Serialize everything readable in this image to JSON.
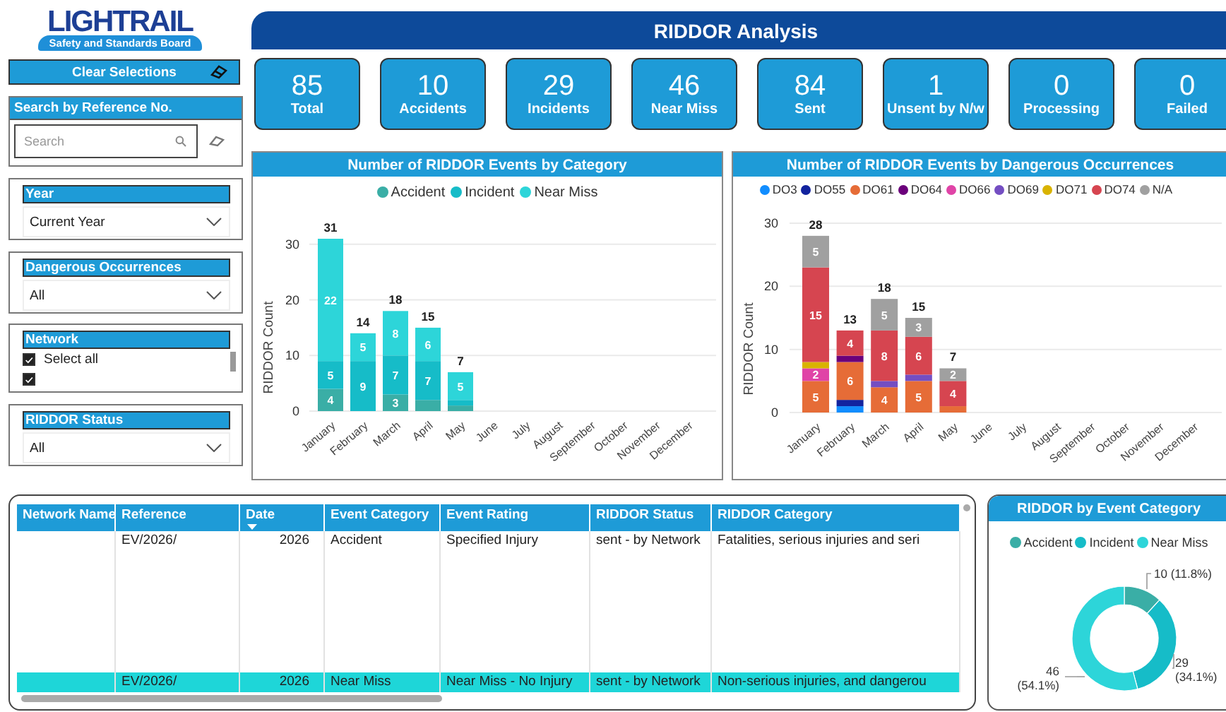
{
  "logo": {
    "name": "LIGHTRAIL",
    "tagline": "Safety and Standards Board"
  },
  "sidebar": {
    "clear_button": "Clear Selections",
    "search": {
      "title": "Search by Reference No.",
      "placeholder": "Search"
    },
    "filters": [
      {
        "kind": "dropdown",
        "title": "Year",
        "value": "Current Year"
      },
      {
        "kind": "dropdown",
        "title": "Dangerous Occurrences",
        "value": "All"
      },
      {
        "kind": "checklist",
        "title": "Network",
        "items": [
          {
            "label": "Select all",
            "checked": true
          },
          {
            "checked": true
          }
        ]
      },
      {
        "kind": "dropdown",
        "title": "RIDDOR Status",
        "value": "All"
      }
    ]
  },
  "header": {
    "title": "RIDDOR Analysis"
  },
  "kpis": [
    {
      "value": "85",
      "label": "Total"
    },
    {
      "value": "10",
      "label": "Accidents"
    },
    {
      "value": "29",
      "label": "Incidents"
    },
    {
      "value": "46",
      "label": "Near Miss"
    },
    {
      "value": "84",
      "label": "Sent"
    },
    {
      "value": "1",
      "label": "Unsent by N/w"
    },
    {
      "value": "0",
      "label": "Processing"
    },
    {
      "value": "0",
      "label": "Failed"
    }
  ],
  "category_chart": {
    "chart_data": {
      "type": "bar",
      "title": "Number of RIDDOR Events by Category",
      "ylabel": "RIDDOR Count",
      "stacked": true,
      "grid": true,
      "ylim": [
        0,
        31
      ],
      "yticks": [
        0,
        10,
        20,
        30
      ],
      "categories": [
        "January",
        "February",
        "March",
        "April",
        "May",
        "June",
        "July",
        "August",
        "September",
        "October",
        "November",
        "December"
      ],
      "series": [
        {
          "name": "Accident",
          "color": "#3aaea6",
          "values": [
            4,
            null,
            3,
            2,
            1,
            null,
            null,
            null,
            null,
            null,
            null,
            null
          ],
          "value_labels": [
            "4",
            null,
            "3",
            null,
            null,
            null,
            null,
            null,
            null,
            null,
            null,
            null
          ]
        },
        {
          "name": "Incident",
          "color": "#16bcc8",
          "values": [
            5,
            9,
            7,
            7,
            1,
            null,
            null,
            null,
            null,
            null,
            null,
            null
          ],
          "value_labels": [
            "5",
            "9",
            "7",
            "7",
            null,
            null,
            null,
            null,
            null,
            null,
            null,
            null
          ]
        },
        {
          "name": "Near Miss",
          "color": "#2dd5d9",
          "values": [
            22,
            5,
            8,
            6,
            5,
            null,
            null,
            null,
            null,
            null,
            null,
            null
          ],
          "value_labels": [
            "22",
            "5",
            "8",
            "6",
            "5",
            null,
            null,
            null,
            null,
            null,
            null,
            null
          ]
        }
      ],
      "annotations": [
        {
          "text": "31"
        },
        {
          "text": "14"
        },
        {
          "text": "18"
        },
        {
          "text": "15"
        },
        {
          "text": "7"
        }
      ]
    }
  },
  "occurrence_chart": {
    "chart_data": {
      "type": "bar",
      "title": "Number of RIDDOR Events by Dangerous Occurrences",
      "ylabel": "RIDDOR Count",
      "stacked": true,
      "grid": true,
      "ylim": [
        0,
        30
      ],
      "yticks": [
        0,
        10,
        20,
        30
      ],
      "categories": [
        "January",
        "February",
        "March",
        "April",
        "May",
        "June",
        "July",
        "August",
        "September",
        "October",
        "November",
        "December"
      ],
      "series": [
        {
          "name": "DO3",
          "color": "#118dff",
          "values": [
            null,
            1,
            null,
            null,
            null,
            null,
            null,
            null,
            null,
            null,
            null,
            null
          ],
          "value_labels": [
            null,
            null,
            null,
            null,
            null,
            null,
            null,
            null,
            null,
            null,
            null,
            null
          ]
        },
        {
          "name": "DO55",
          "color": "#12239e",
          "values": [
            null,
            1,
            null,
            null,
            null,
            null,
            null,
            null,
            null,
            null,
            null,
            null
          ],
          "value_labels": [
            null,
            null,
            null,
            null,
            null,
            null,
            null,
            null,
            null,
            null,
            null,
            null
          ]
        },
        {
          "name": "DO61",
          "color": "#e66c37",
          "values": [
            5,
            6,
            4,
            5,
            1,
            null,
            null,
            null,
            null,
            null,
            null,
            null
          ],
          "value_labels": [
            "5",
            "6",
            "4",
            "5",
            null,
            null,
            null,
            null,
            null,
            null,
            null,
            null
          ]
        },
        {
          "name": "DO64",
          "color": "#6b007b",
          "values": [
            null,
            1,
            null,
            null,
            null,
            null,
            null,
            null,
            null,
            null,
            null,
            null
          ],
          "value_labels": [
            null,
            null,
            null,
            null,
            null,
            null,
            null,
            null,
            null,
            null,
            null,
            null
          ]
        },
        {
          "name": "DO66",
          "color": "#e044a7",
          "values": [
            2,
            null,
            null,
            null,
            null,
            null,
            null,
            null,
            null,
            null,
            null,
            null
          ],
          "value_labels": [
            "2",
            null,
            null,
            null,
            null,
            null,
            null,
            null,
            null,
            null,
            null,
            null
          ]
        },
        {
          "name": "DO69",
          "color": "#744ec2",
          "values": [
            null,
            null,
            1,
            1,
            null,
            null,
            null,
            null,
            null,
            null,
            null,
            null
          ],
          "value_labels": [
            null,
            null,
            null,
            null,
            null,
            null,
            null,
            null,
            null,
            null,
            null,
            null
          ]
        },
        {
          "name": "DO71",
          "color": "#d9b300",
          "values": [
            1,
            null,
            null,
            null,
            null,
            null,
            null,
            null,
            null,
            null,
            null,
            null
          ],
          "value_labels": [
            null,
            null,
            null,
            null,
            null,
            null,
            null,
            null,
            null,
            null,
            null,
            null
          ]
        },
        {
          "name": "DO74",
          "color": "#d64550",
          "values": [
            15,
            4,
            8,
            6,
            4,
            null,
            null,
            null,
            null,
            null,
            null,
            null
          ],
          "value_labels": [
            "15",
            "4",
            "8",
            "6",
            "4",
            null,
            null,
            null,
            null,
            null,
            null,
            null
          ]
        },
        {
          "name": "N/A",
          "color": "#a0a0a0",
          "values": [
            5,
            null,
            5,
            3,
            2,
            null,
            null,
            null,
            null,
            null,
            null,
            null
          ],
          "value_labels": [
            "5",
            null,
            "5",
            "3",
            "2",
            null,
            null,
            null,
            null,
            null,
            null,
            null
          ]
        }
      ],
      "annotations": [
        {
          "text": "28"
        },
        {
          "text": "13"
        },
        {
          "text": "18"
        },
        {
          "text": "15"
        },
        {
          "text": "7"
        }
      ]
    }
  },
  "table": {
    "columns": [
      {
        "label": "Network Name",
        "sorted": false
      },
      {
        "label": "Reference",
        "sorted": false
      },
      {
        "label": "Date",
        "sorted": true
      },
      {
        "label": "Event Category",
        "sorted": false
      },
      {
        "label": "Event Rating",
        "sorted": false
      },
      {
        "label": "RIDDOR Status",
        "sorted": false
      },
      {
        "label": "RIDDOR Category",
        "sorted": false
      }
    ],
    "rows": [
      {
        "selected": false,
        "cells": [
          null,
          "EV/2026/",
          "2026",
          "Accident",
          "Specified Injury",
          "sent - by Network",
          "Fatalities, serious injuries and seri"
        ]
      },
      {
        "selected": true,
        "cells": [
          null,
          "EV/2026/",
          "2026",
          "Near Miss",
          "Near Miss - No Injury",
          "sent - by Network",
          "Non-serious injuries, and dangerou"
        ]
      }
    ]
  },
  "donut": {
    "chart_data": {
      "type": "donut",
      "title": "RIDDOR by Event Category",
      "categories": [
        "Accident",
        "Incident",
        "Near Miss"
      ],
      "values": [
        10,
        29,
        46
      ],
      "colors": [
        "#3aaea6",
        "#16bcc8",
        "#2dd5d9"
      ],
      "value_labels": [
        "10 (11.8%)",
        "29 (34.1%)",
        "46 (54.1%)"
      ]
    }
  }
}
